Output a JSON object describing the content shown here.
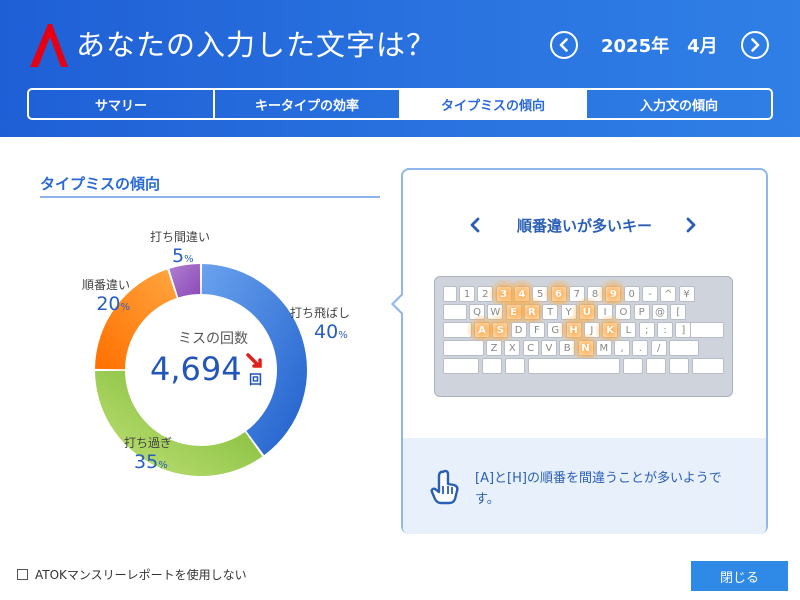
{
  "header": {
    "title": "あなたの入力した文字は？",
    "month_label": "2025年　4月",
    "tabs": [
      {
        "label": "サマリー",
        "active": false
      },
      {
        "label": "キータイプの効率",
        "active": false
      },
      {
        "label": "タイプミスの傾向",
        "active": true
      },
      {
        "label": "入力文の傾向",
        "active": false
      }
    ]
  },
  "section": {
    "title": "タイプミスの傾向"
  },
  "summary": {
    "center_label": "ミスの回数",
    "total_value": "4,694",
    "total_unit": "回",
    "trend": "up"
  },
  "chart_data": {
    "type": "pie",
    "categories": [
      "打ち飛ばし",
      "打ち過ぎ",
      "順番違い",
      "打ち間違い"
    ],
    "values": [
      40,
      35,
      20,
      5
    ],
    "colors": [
      "#2e6fd8",
      "#8cc63f",
      "#ff8a1a",
      "#9b59b6"
    ]
  },
  "segment_labels": [
    {
      "name": "打ち飛ばし",
      "pct": "40",
      "unit": "%"
    },
    {
      "name": "打ち過ぎ",
      "pct": "35",
      "unit": "%"
    },
    {
      "name": "順番違い",
      "pct": "20",
      "unit": "%"
    },
    {
      "name": "打ち間違い",
      "pct": "5",
      "unit": "%"
    }
  ],
  "panel": {
    "title": "順番違いが多いキー",
    "tip": "[A]と[H]の順番を間違うことが多いようです。",
    "keyboard": {
      "row1": [
        "",
        "1",
        "2",
        "3",
        "4",
        "5",
        "6",
        "7",
        "8",
        "9",
        "0",
        "-",
        "^",
        "¥"
      ],
      "row2": [
        "",
        "Q",
        "W",
        "E",
        "R",
        "T",
        "Y",
        "U",
        "I",
        "O",
        "P",
        "@",
        "["
      ],
      "row3": [
        "",
        "A",
        "S",
        "D",
        "F",
        "G",
        "H",
        "J",
        "K",
        "L",
        ";",
        ":",
        "]"
      ],
      "row4": [
        "",
        "Z",
        "X",
        "C",
        "V",
        "B",
        "N",
        "M",
        ",",
        ".",
        "/",
        ""
      ],
      "hot_keys": [
        "E",
        "R",
        "U",
        "A",
        "S",
        "H",
        "K",
        "N",
        "3",
        "4",
        "6",
        "9"
      ]
    }
  },
  "footer": {
    "checkbox_label": "ATOKマンスリーレポートを使用しない",
    "checkbox_checked": false,
    "close_label": "閉じる"
  }
}
